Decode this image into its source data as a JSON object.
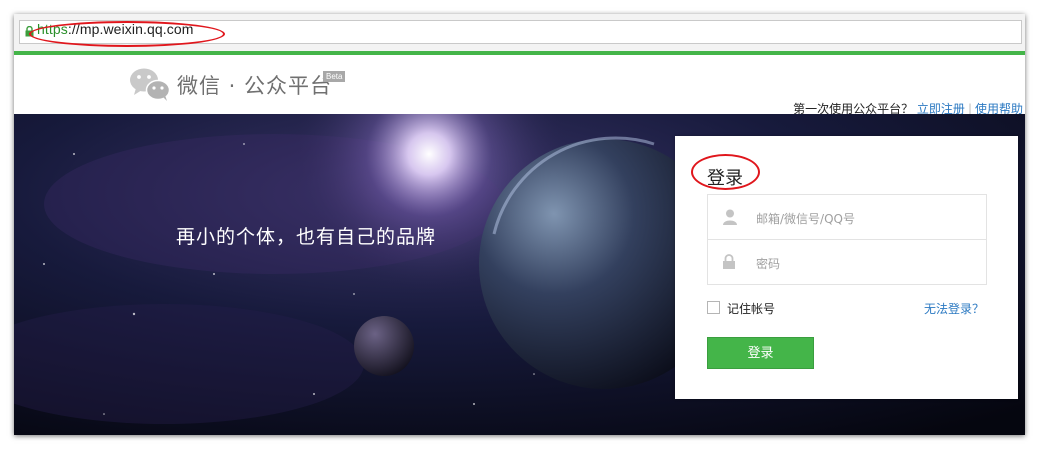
{
  "browser": {
    "url_scheme": "https",
    "url_rest": "://mp.weixin.qq.com"
  },
  "header": {
    "logo_text": "微信 · 公众平台",
    "beta_badge": "Beta",
    "first_time_text": "第一次使用公众平台？",
    "register_link": "立即注册",
    "separator": "|",
    "help_link": "使用帮助"
  },
  "banner": {
    "slogan": "再小的个体，也有自己的品牌"
  },
  "login": {
    "title": "登录",
    "account_placeholder": "邮箱/微信号/QQ号",
    "password_placeholder": "密码",
    "remember_label": "记住帐号",
    "forgot_link": "无法登录？",
    "submit_label": "登录"
  },
  "colors": {
    "brand_green": "#44b549",
    "link_blue": "#2b79c2",
    "annotation_red": "#e0161c"
  }
}
